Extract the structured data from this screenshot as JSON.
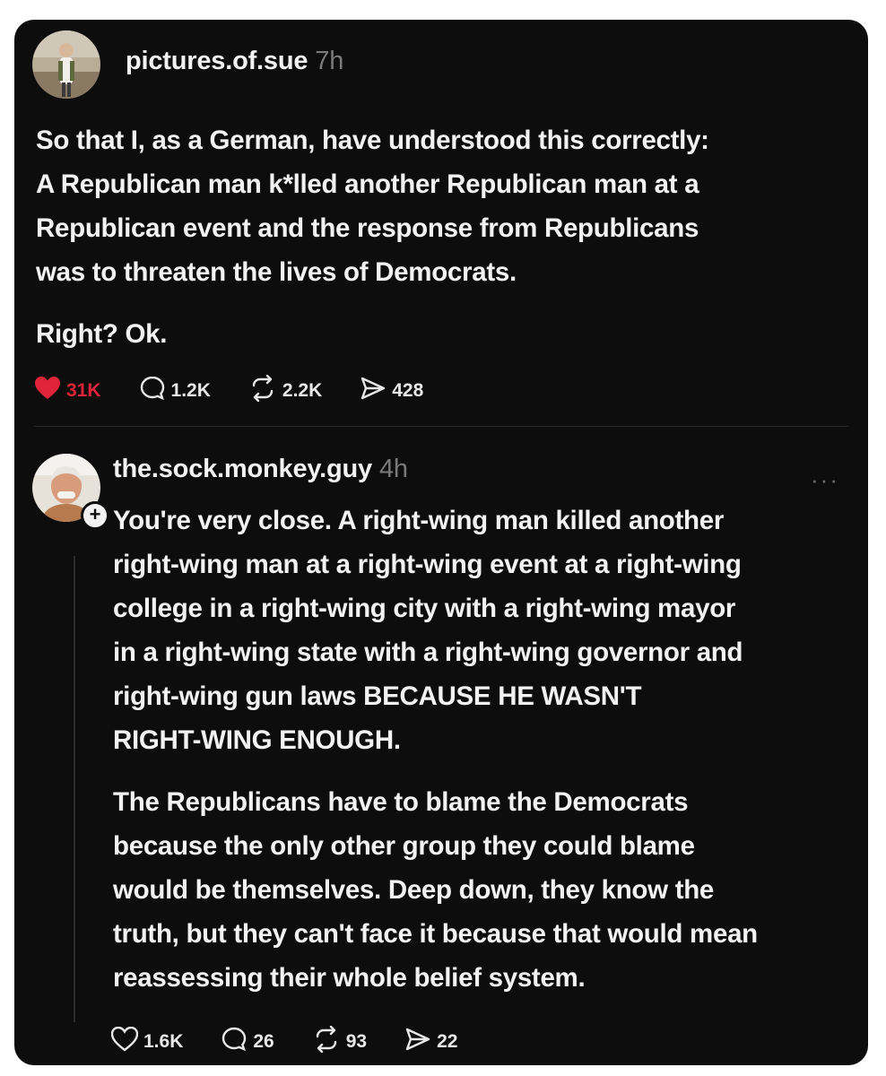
{
  "post": {
    "username": "pictures.of.sue",
    "time": "7h",
    "lines": [
      "So that I, as a German, have understood this correctly:",
      "A Republican man k*lled another Republican man at a",
      "Republican event and the response from Republicans",
      "was to threaten the lives of Democrats."
    ],
    "paragraph2": "Right? Ok.",
    "likes": "31K",
    "replies": "1.2K",
    "reposts": "2.2K",
    "shares": "428",
    "like_color": "#e0243a"
  },
  "reply": {
    "username": "the.sock.monkey.guy",
    "time": "4h",
    "more_label": "···",
    "follow_label": "+",
    "lines1": [
      "You're very close. A right-wing man killed another",
      "right-wing man at a right-wing event at a right-wing",
      "college in a right-wing city with a right-wing mayor",
      "in a right-wing state with a right-wing governor and",
      "right-wing gun laws BECAUSE HE WASN'T",
      "RIGHT-WING ENOUGH."
    ],
    "lines2": [
      "The Republicans have to blame the Democrats",
      "because the only other group they could blame",
      "would be themselves. Deep down, they know the",
      "truth, but they can't face it because that would mean",
      "reassessing their whole belief system."
    ],
    "likes": "1.6K",
    "replies": "26",
    "reposts": "93",
    "shares": "22"
  },
  "icons": [
    "heart-icon",
    "comment-icon",
    "repost-icon",
    "share-icon",
    "more-icon",
    "plus-icon"
  ]
}
